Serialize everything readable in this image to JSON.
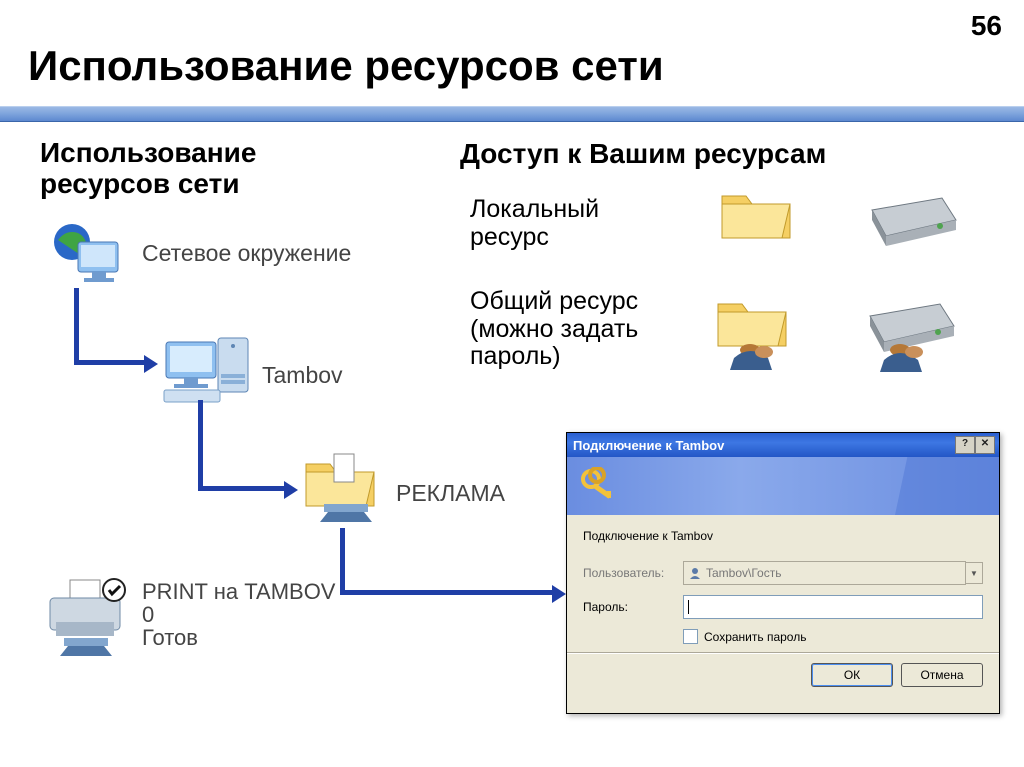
{
  "slide": {
    "page_number": "56",
    "title": "Использование ресурсов сети"
  },
  "left": {
    "heading": "Использование\nресурсов сети",
    "network_places": "Сетевое окружение",
    "computer_name": "Tambov",
    "share_name": "РЕКЛАМА",
    "printer_name": "PRINT на TAMBOV",
    "printer_count": "0",
    "printer_status": "Готов"
  },
  "right": {
    "heading": "Доступ к Вашим ресурсам",
    "local_resource": "Локальный\nресурс",
    "shared_resource": "Общий ресурс\n(можно задать\nпароль)"
  },
  "dialog": {
    "title": "Подключение к Tambov",
    "body_heading": "Подключение к Tambov",
    "user_label": "Пользователь:",
    "user_value": "Tambov\\Гость",
    "password_label": "Пароль:",
    "password_value": "",
    "remember_label": "Сохранить пароль",
    "ok": "ОК",
    "cancel": "Отмена"
  },
  "icon_names": {
    "network_places": "network-places-icon",
    "computer": "computer-icon",
    "shared_folder": "shared-folder-icon",
    "printer": "network-printer-icon",
    "folder_plain": "folder-icon",
    "drive_plain": "drive-icon",
    "folder_shared": "shared-folder-icon",
    "drive_shared": "shared-drive-icon",
    "keys": "keys-icon",
    "user": "user-icon"
  }
}
